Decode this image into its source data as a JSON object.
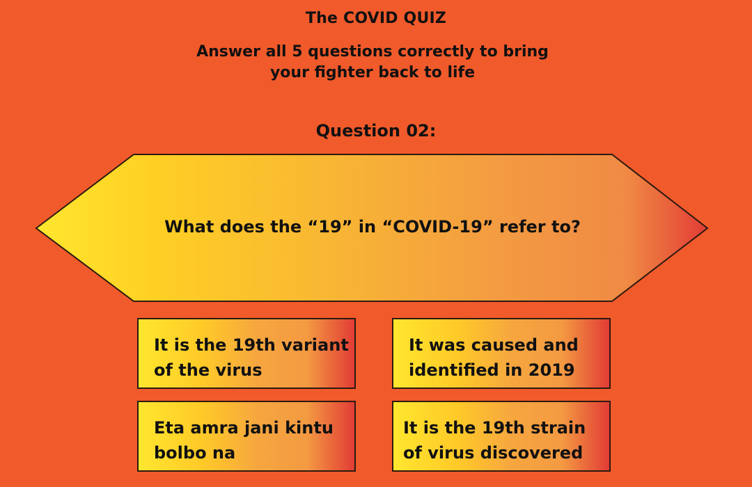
{
  "quiz": {
    "title": "The COVID QUIZ",
    "subtitle": "Answer all 5 questions correctly to bring your fighter back to life",
    "question_label": "Question 02:",
    "question_text": "What does the “19” in “COVID-19” refer to?",
    "options": [
      {
        "text": "It is the 19th variant of the virus"
      },
      {
        "text": "It was caused and identified in 2019"
      },
      {
        "text": "Eta amra jani kintu bolbo na"
      },
      {
        "text": "It is the 19th strain of virus discovered"
      }
    ]
  },
  "colors": {
    "background": "#f15a2b",
    "gradient_start": "#ffe62e",
    "gradient_end": "#e23c35",
    "border": "#2a1a10"
  }
}
